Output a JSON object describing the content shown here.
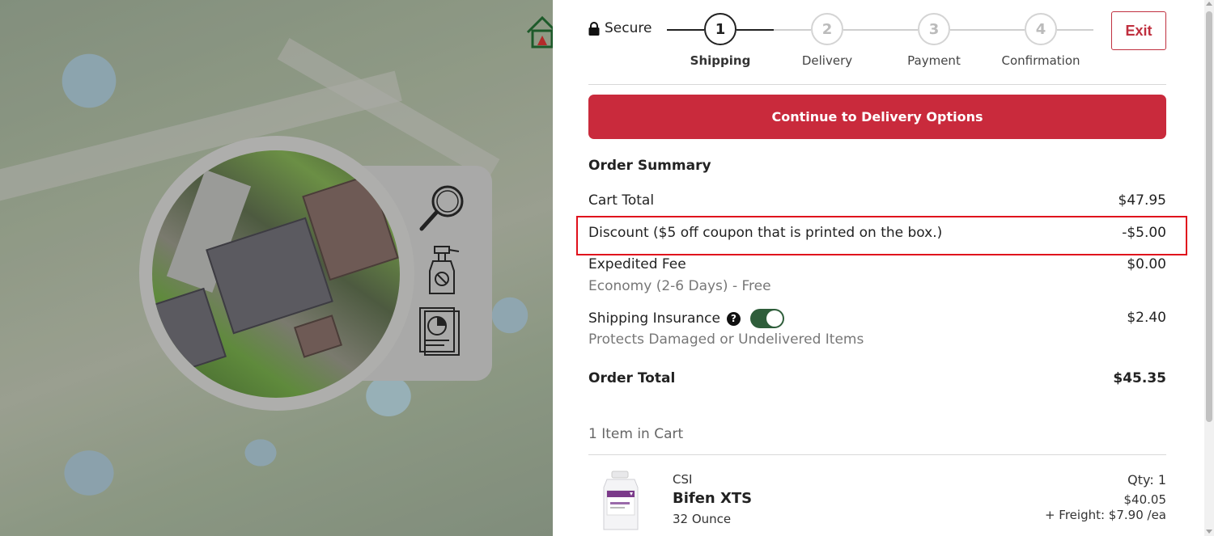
{
  "header": {
    "secure_label": "Secure",
    "exit_label": "Exit"
  },
  "stepper": {
    "steps": [
      {
        "number": "1",
        "label": "Shipping",
        "active": true
      },
      {
        "number": "2",
        "label": "Delivery",
        "active": false
      },
      {
        "number": "3",
        "label": "Payment",
        "active": false
      },
      {
        "number": "4",
        "label": "Confirmation",
        "active": false
      }
    ]
  },
  "actions": {
    "continue_label": "Continue to Delivery Options"
  },
  "summary": {
    "title": "Order Summary",
    "cart_total_label": "Cart Total",
    "cart_total_value": "$47.95",
    "discount_label": "Discount ($5 off coupon that is printed on the box.)",
    "discount_value": "-$5.00",
    "expedited_label": "Expedited Fee",
    "expedited_value": "$0.00",
    "expedited_sub": "Economy (2-6 Days) - Free",
    "insurance_label": "Shipping Insurance",
    "insurance_value": "$2.40",
    "insurance_sub": "Protects Damaged or Undelivered Items",
    "insurance_enabled": true,
    "order_total_label": "Order Total",
    "order_total_value": "$45.35"
  },
  "cart": {
    "count_label": "1 Item in Cart",
    "items": [
      {
        "brand": "CSI",
        "name": "Bifen XTS",
        "size": "32 Ounce",
        "qty": "Qty: 1",
        "price": "$40.05",
        "freight": "+ Freight: $7.90 /ea"
      }
    ]
  },
  "colors": {
    "accent": "#c92a3c",
    "highlight": "#e0101c",
    "toggle_on": "#2e5d3a"
  }
}
